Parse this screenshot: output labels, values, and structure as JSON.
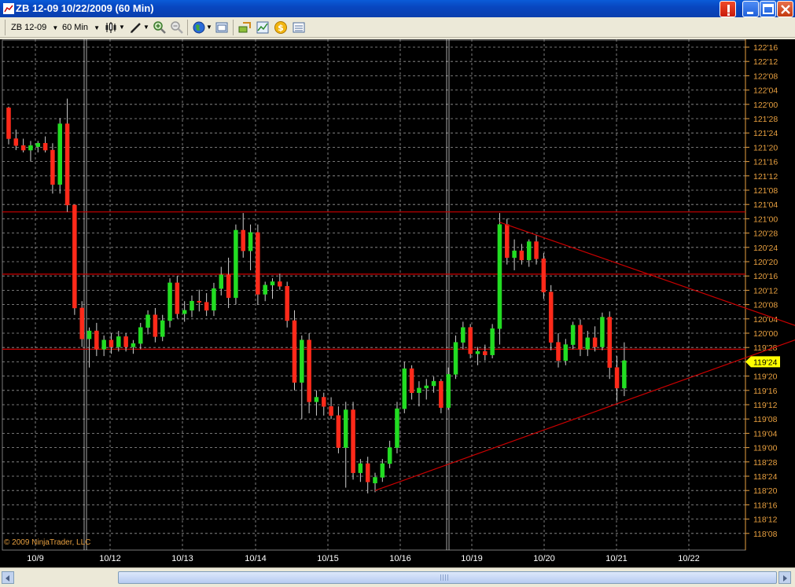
{
  "window": {
    "title": "ZB 12-09  10/22/2009 (60 Min)",
    "buttons": [
      "alert",
      "minimize",
      "maximize",
      "close"
    ]
  },
  "toolbar": {
    "instrument": "ZB 12-09",
    "interval": "60 Min",
    "icons": [
      "bar-type-icon",
      "draw-tool-icon",
      "zoom-in-icon",
      "zoom-out-icon",
      "globe-icon",
      "properties-icon",
      "strategy-icon",
      "indicator-icon",
      "chart-trader-icon",
      "data-box-icon"
    ]
  },
  "colors": {
    "background": "#000000",
    "grid": "#9a9a9a",
    "up_candle": "#22dd22",
    "down_candle": "#ff2a1a",
    "line": "#cc0000",
    "price_axis_text": "#e8a040",
    "last_price_bg": "#ffff00"
  },
  "chart_data": {
    "type": "candlestick",
    "instrument": "ZB 12-09",
    "interval": "60 Min",
    "y_unit": "32nds",
    "y_ticks": [
      "122'16",
      "122'12",
      "122'08",
      "122'04",
      "122'00",
      "121'28",
      "121'24",
      "121'20",
      "121'16",
      "121'12",
      "121'08",
      "121'04",
      "121'00",
      "120'28",
      "120'24",
      "120'20",
      "120'16",
      "120'12",
      "120'08",
      "120'04",
      "120'00",
      "119'28",
      "119'24",
      "119'20",
      "119'16",
      "119'12",
      "119'08",
      "119'04",
      "119'00",
      "118'28",
      "118'24",
      "118'20",
      "118'16",
      "118'12",
      "118'08"
    ],
    "ylim": [
      118.16,
      122.63
    ],
    "x_ticks": [
      "10/9",
      "10/12",
      "10/13",
      "10/14",
      "10/15",
      "10/16",
      "10/19",
      "10/20",
      "10/21",
      "10/22"
    ],
    "last_price": "119'24",
    "copyright": "© 2009 NinjaTrader, LLC",
    "horizontal_lines": [
      121.06,
      120.516,
      119.86
    ],
    "trendlines": [
      {
        "from": [
          67,
          120.97
        ],
        "to": [
          109,
          120.03
        ]
      },
      {
        "from": [
          50,
          118.625
        ],
        "to": [
          109,
          119.98
        ]
      }
    ],
    "candles": [
      [
        121.97,
        121.98,
        121.65,
        121.7
      ],
      [
        121.7,
        121.78,
        121.6,
        121.64
      ],
      [
        121.64,
        121.7,
        121.58,
        121.6
      ],
      [
        121.6,
        121.68,
        121.5,
        121.64
      ],
      [
        121.63,
        121.68,
        121.58,
        121.66
      ],
      [
        121.66,
        121.72,
        121.58,
        121.6
      ],
      [
        121.6,
        121.66,
        121.22,
        121.3
      ],
      [
        121.3,
        121.88,
        121.22,
        121.83
      ],
      [
        121.83,
        122.05,
        121.06,
        121.12
      ],
      [
        121.12,
        121.12,
        120.16,
        120.22
      ],
      [
        120.22,
        120.28,
        119.88,
        119.95
      ],
      [
        119.95,
        120.05,
        119.7,
        120.02
      ],
      [
        120.02,
        120.09,
        119.8,
        119.86
      ],
      [
        119.86,
        119.98,
        119.8,
        119.94
      ],
      [
        119.94,
        120.0,
        119.82,
        119.88
      ],
      [
        119.88,
        120.02,
        119.84,
        119.97
      ],
      [
        119.97,
        120.0,
        119.84,
        119.88
      ],
      [
        119.88,
        119.94,
        119.82,
        119.91
      ],
      [
        119.91,
        120.09,
        119.86,
        120.05
      ],
      [
        120.05,
        120.2,
        119.99,
        120.16
      ],
      [
        120.16,
        120.22,
        119.92,
        119.97
      ],
      [
        119.97,
        120.16,
        119.93,
        120.11
      ],
      [
        120.11,
        120.48,
        120.05,
        120.44
      ],
      [
        120.44,
        120.5,
        120.13,
        120.17
      ],
      [
        120.17,
        120.28,
        120.1,
        120.2
      ],
      [
        120.2,
        120.33,
        120.14,
        120.28
      ],
      [
        120.28,
        120.38,
        120.19,
        120.27
      ],
      [
        120.27,
        120.35,
        120.15,
        120.2
      ],
      [
        120.2,
        120.44,
        120.15,
        120.39
      ],
      [
        120.39,
        120.58,
        120.33,
        120.51
      ],
      [
        120.51,
        120.66,
        120.22,
        120.31
      ],
      [
        120.31,
        120.95,
        120.25,
        120.9
      ],
      [
        120.9,
        121.05,
        120.66,
        120.72
      ],
      [
        120.72,
        120.95,
        120.55,
        120.88
      ],
      [
        120.88,
        120.95,
        120.25,
        120.34
      ],
      [
        120.34,
        120.45,
        120.28,
        120.42
      ],
      [
        120.42,
        120.48,
        120.3,
        120.45
      ],
      [
        120.45,
        120.52,
        120.38,
        120.41
      ],
      [
        120.41,
        120.45,
        120.05,
        120.11
      ],
      [
        120.11,
        120.2,
        119.5,
        119.57
      ],
      [
        119.57,
        119.98,
        119.25,
        119.94
      ],
      [
        119.94,
        120.0,
        119.3,
        119.4
      ],
      [
        119.4,
        119.5,
        119.28,
        119.44
      ],
      [
        119.44,
        119.48,
        119.28,
        119.36
      ],
      [
        119.36,
        119.44,
        119.25,
        119.28
      ],
      [
        119.28,
        119.36,
        118.95,
        119.0
      ],
      [
        119.0,
        119.4,
        118.65,
        119.33
      ],
      [
        119.33,
        119.4,
        118.72,
        118.78
      ],
      [
        118.78,
        118.9,
        118.7,
        118.86
      ],
      [
        118.86,
        118.92,
        118.6,
        118.7
      ],
      [
        118.69,
        118.78,
        118.61,
        118.74
      ],
      [
        118.74,
        118.9,
        118.7,
        118.86
      ],
      [
        118.86,
        119.06,
        118.82,
        119.0
      ],
      [
        119.0,
        119.4,
        118.95,
        119.34
      ],
      [
        119.34,
        119.75,
        119.3,
        119.69
      ],
      [
        119.69,
        119.72,
        119.42,
        119.48
      ],
      [
        119.48,
        119.58,
        119.36,
        119.52
      ],
      [
        119.52,
        119.6,
        119.42,
        119.54
      ],
      [
        119.54,
        119.62,
        119.48,
        119.58
      ],
      [
        119.58,
        119.6,
        119.3,
        119.35
      ],
      [
        119.35,
        119.7,
        119.33,
        119.64
      ],
      [
        119.64,
        119.98,
        119.6,
        119.92
      ],
      [
        119.92,
        120.1,
        119.86,
        120.05
      ],
      [
        120.05,
        120.08,
        119.78,
        119.82
      ],
      [
        119.82,
        119.88,
        119.72,
        119.84
      ],
      [
        119.84,
        119.9,
        119.76,
        119.81
      ],
      [
        119.81,
        120.08,
        119.78,
        120.04
      ],
      [
        120.04,
        121.05,
        119.9,
        120.95
      ],
      [
        120.95,
        121.0,
        120.6,
        120.66
      ],
      [
        120.66,
        120.82,
        120.55,
        120.72
      ],
      [
        120.72,
        120.78,
        120.6,
        120.64
      ],
      [
        120.64,
        120.82,
        120.58,
        120.8
      ],
      [
        120.8,
        120.86,
        120.6,
        120.65
      ],
      [
        120.65,
        120.7,
        120.3,
        120.36
      ],
      [
        120.36,
        120.42,
        119.85,
        119.92
      ],
      [
        119.92,
        120.0,
        119.7,
        119.76
      ],
      [
        119.76,
        119.95,
        119.72,
        119.9
      ],
      [
        119.9,
        120.1,
        119.86,
        120.07
      ],
      [
        120.07,
        120.12,
        119.8,
        119.86
      ],
      [
        119.86,
        120.02,
        119.8,
        119.96
      ],
      [
        119.96,
        120.06,
        119.84,
        119.88
      ],
      [
        119.88,
        120.18,
        119.85,
        120.14
      ],
      [
        120.14,
        120.19,
        119.6,
        119.7
      ],
      [
        119.7,
        119.8,
        119.4,
        119.52
      ],
      [
        119.52,
        119.92,
        119.45,
        119.76
      ]
    ]
  }
}
